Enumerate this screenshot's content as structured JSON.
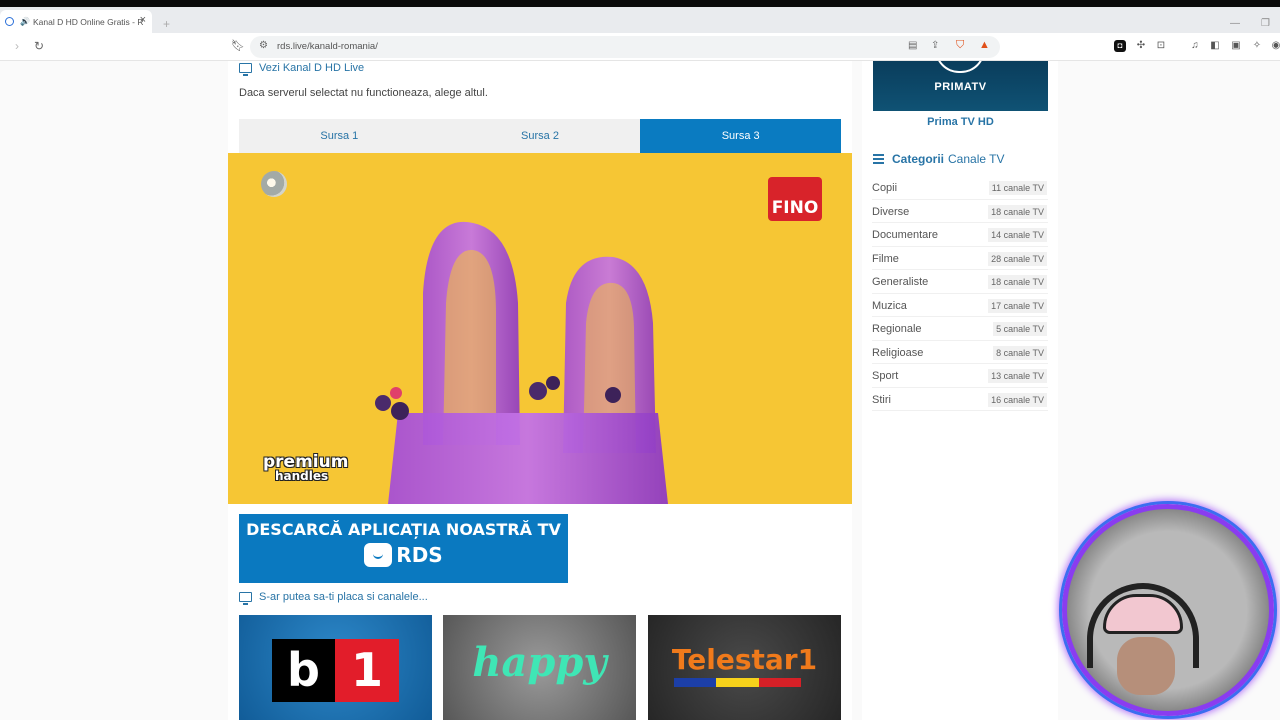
{
  "browser": {
    "tab_title": "Kanal D HD Online Gratis - RD",
    "url": "rds.live/kanald-romania/"
  },
  "main": {
    "live_heading": "Vezi Kanal D HD Live",
    "notice": "Daca serverul selectat nu functioneaza, alege altul.",
    "source_tabs": [
      {
        "label": "Sursa 1",
        "active": false
      },
      {
        "label": "Sursa 2",
        "active": false
      },
      {
        "label": "Sursa 3",
        "active": true
      }
    ],
    "player": {
      "sponsor_logo": "FINO",
      "overlay_line1": "premium",
      "overlay_line2": "handles"
    },
    "banner": {
      "line1": "DESCARCĂ APLICAȚIA NOASTRĂ TV",
      "brand": "RDS"
    },
    "suggest_heading": "S-ar putea sa-ti placa si canalele...",
    "suggested_channels": [
      {
        "name": "b1",
        "label_b": "b",
        "label_num": "1"
      },
      {
        "name": "happy",
        "label": "happy"
      },
      {
        "name": "Telestar1",
        "label": "Telestar1"
      }
    ]
  },
  "sidebar": {
    "featured_logo": "PRIMATV",
    "featured_name": "Prima TV HD",
    "categories_heading_bold": "Categorii",
    "categories_heading_rest": "Canale TV",
    "categories": [
      {
        "name": "Copii",
        "count": "11 canale TV"
      },
      {
        "name": "Diverse",
        "count": "18 canale TV"
      },
      {
        "name": "Documentare",
        "count": "14 canale TV"
      },
      {
        "name": "Filme",
        "count": "28 canale TV"
      },
      {
        "name": "Generaliste",
        "count": "18 canale TV"
      },
      {
        "name": "Muzica",
        "count": "17 canale TV"
      },
      {
        "name": "Regionale",
        "count": "5 canale TV"
      },
      {
        "name": "Religioase",
        "count": "8 canale TV"
      },
      {
        "name": "Sport",
        "count": "13 canale TV"
      },
      {
        "name": "Stiri",
        "count": "16 canale TV"
      }
    ]
  },
  "colors": {
    "accent": "#0a7bc1",
    "link": "#2874a6",
    "player_bg": "#f7c933"
  }
}
